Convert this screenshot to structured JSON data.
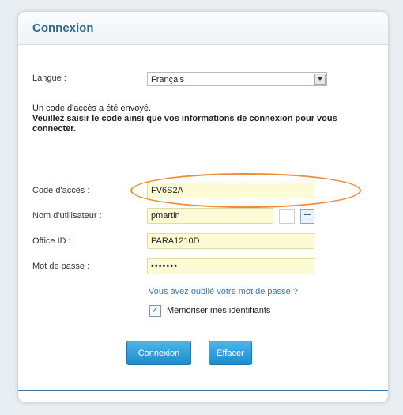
{
  "panel": {
    "title": "Connexion"
  },
  "language": {
    "label": "Langue :",
    "selected": "Français"
  },
  "message": {
    "line1": "Un code d'accès a été envoyé.",
    "line2": "Veuillez saisir le code ainsi que vos informations de connexion pour vous connecter."
  },
  "fields": {
    "access_code_label": "Code d'accès :",
    "access_code_value": "FV6S2A",
    "username_label": "Nom d'utilisateur :",
    "username_value": "pmartin",
    "office_id_label": "Office ID :",
    "office_id_value": "PARA1210D",
    "password_label": "Mot de passe :",
    "password_value": "•••••••"
  },
  "links": {
    "forgot_password": "Vous avez oublié votre mot de passe ?"
  },
  "remember": {
    "label": "Mémoriser mes identifiants",
    "checked": true
  },
  "buttons": {
    "connect": "Connexion",
    "clear": "Effacer"
  },
  "colors": {
    "title": "#2e6a8f",
    "highlight_oval": "#f28c33",
    "button": "#1d8ccd",
    "field_bg": "#fdfbd6"
  }
}
